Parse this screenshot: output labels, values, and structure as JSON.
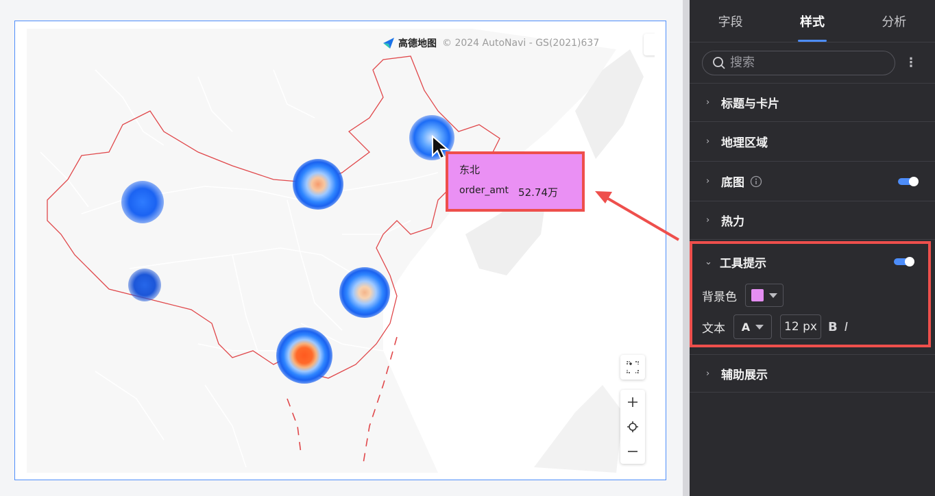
{
  "map": {
    "attribution_logo": "高德地图",
    "attribution_text": "© 2024 AutoNavi - GS(2021)637",
    "more_icon": "more-vertical-icon",
    "controls": {
      "fullscreen_icon": "fullscreen-icon",
      "zoom_in_icon": "plus-icon",
      "locate_icon": "locate-icon",
      "zoom_out_icon": "minus-icon"
    },
    "heat_colors": [
      "#1a62f0",
      "#2f86ff",
      "#9ec8ff",
      "#f7b27c",
      "#ff5a1f"
    ]
  },
  "tooltip": {
    "title": "东北",
    "metric": "order_amt",
    "value": "52.74万",
    "background": "#ea90f4",
    "highlight_border": "#ee4f4c"
  },
  "panel": {
    "tabs": [
      {
        "label": "字段"
      },
      {
        "label": "样式"
      },
      {
        "label": "分析"
      }
    ],
    "active_tab": "样式",
    "search": {
      "placeholder": "搜索",
      "value": ""
    },
    "sections": [
      {
        "label": "标题与卡片"
      },
      {
        "label": "地理区域"
      },
      {
        "label": "底图",
        "toggle": true
      },
      {
        "label": "热力"
      },
      {
        "label": "工具提示",
        "toggle": true,
        "expanded": true
      },
      {
        "label": "辅助展示"
      }
    ],
    "tooltip_settings": {
      "bg_label": "背景色",
      "bg_color": "#e58ef2",
      "text_label": "文本",
      "font_icon": "A",
      "font_size": "12 px",
      "bold": "B",
      "italic": "I"
    },
    "accent": "#4d8dfa"
  }
}
